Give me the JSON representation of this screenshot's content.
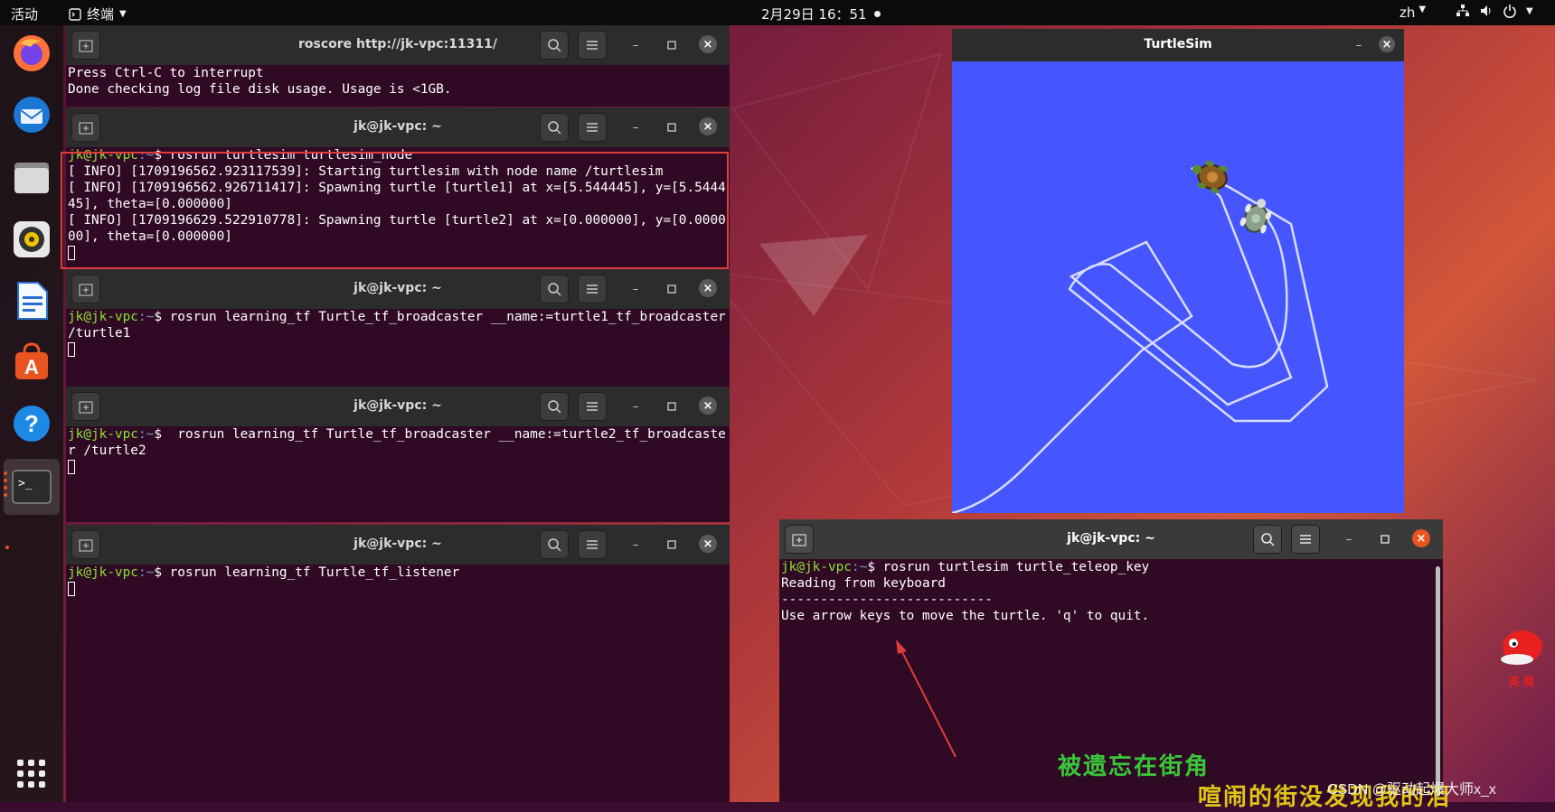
{
  "topbar": {
    "activities": "活动",
    "app_name": "终端",
    "clock": "2月29日 16：51",
    "lang": "zh"
  },
  "dock": {
    "items": [
      {
        "name": "firefox-icon"
      },
      {
        "name": "thunderbird-icon"
      },
      {
        "name": "files-icon"
      },
      {
        "name": "rhythmbox-icon"
      },
      {
        "name": "libreoffice-writer-icon"
      },
      {
        "name": "ubuntu-software-icon"
      },
      {
        "name": "help-icon"
      },
      {
        "name": "terminal-icon"
      }
    ]
  },
  "windows": {
    "roscore": {
      "title": "roscore http://jk-vpc:11311/",
      "lines": [
        "Press Ctrl-C to interrupt",
        "Done checking log file disk usage. Usage is <1GB."
      ]
    },
    "turtlesim_node": {
      "title": "jk@jk-vpc: ~",
      "prompt_user": "jk@jk-vpc",
      "prompt_path": ":~",
      "command": "$ rosrun turtlesim turtlesim_node",
      "output": "[ INFO] [1709196562.923117539]: Starting turtlesim with node name /turtlesim\n[ INFO] [1709196562.926711417]: Spawning turtle [turtle1] at x=[5.544445], y=[5.544445], theta=[0.000000]\n[ INFO] [1709196629.522910778]: Spawning turtle [turtle2] at x=[0.000000], y=[0.000000], theta=[0.000000]"
    },
    "broadcaster1": {
      "title": "jk@jk-vpc: ~",
      "prompt_user": "jk@jk-vpc",
      "prompt_path": ":~",
      "command": "$ rosrun learning_tf Turtle_tf_broadcaster __name:=turtle1_tf_broadcaster /turtle1"
    },
    "broadcaster2": {
      "title": "jk@jk-vpc: ~",
      "prompt_user": "jk@jk-vpc",
      "prompt_path": ":~",
      "command": "$  rosrun learning_tf Turtle_tf_broadcaster __name:=turtle2_tf_broadcaster /turtle2"
    },
    "listener": {
      "title": "jk@jk-vpc: ~",
      "prompt_user": "jk@jk-vpc",
      "prompt_path": ":~",
      "command": "$ rosrun learning_tf Turtle_tf_listener"
    },
    "teleop": {
      "title": "jk@jk-vpc: ~",
      "prompt_user": "jk@jk-vpc",
      "prompt_path": ":~",
      "command": "$ rosrun turtlesim turtle_teleop_key",
      "output": "Reading from keyboard\n---------------------------\nUse arrow keys to move the turtle. 'q' to quit."
    }
  },
  "turtlesim": {
    "title": "TurtleSim",
    "background": "#4556ff"
  },
  "watermarks": {
    "line1": "被遗忘在街角",
    "line2": "喧闹的街没发现我的泪",
    "csdn": "CSDN @驱动起爆大师x_x",
    "pet_label": "英 简"
  },
  "colors": {
    "terminal_bg": "#300a24",
    "prompt_user": "#8ae234",
    "prompt_path": "#729fcf",
    "highlight": "#e03c3c",
    "close_active": "#e95420"
  }
}
